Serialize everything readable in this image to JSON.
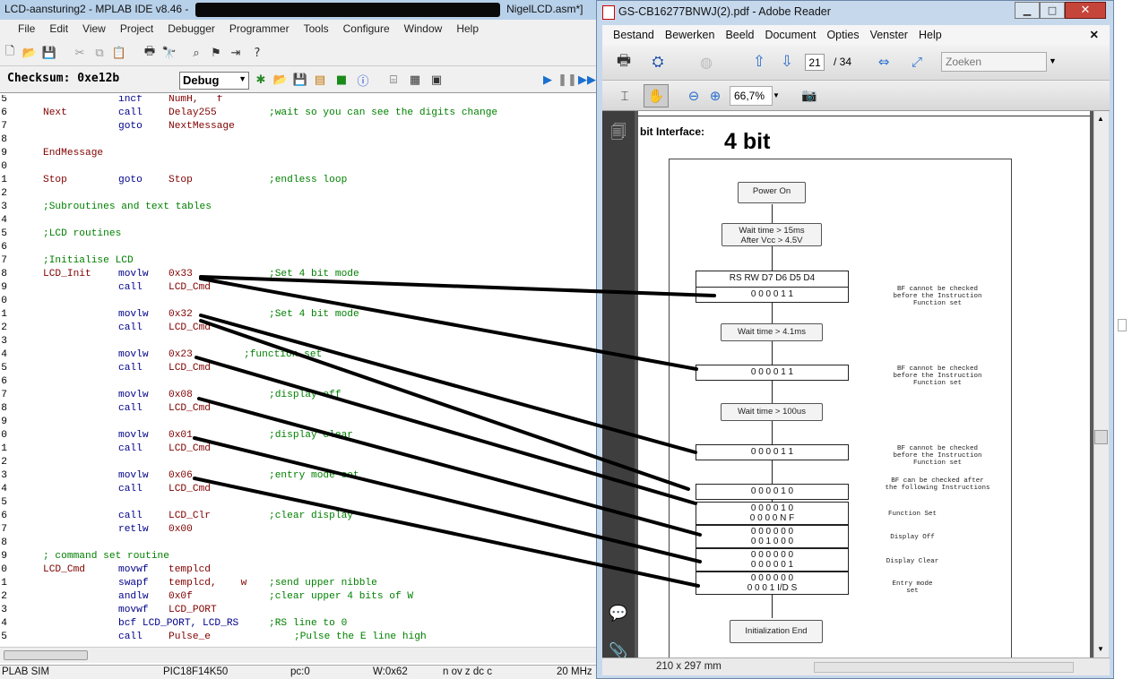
{
  "mplab": {
    "title_left": "LCD-aansturing2  - MPLAB IDE v8.46 -",
    "title_right": "NigelLCD.asm*]",
    "menu": [
      "File",
      "Edit",
      "View",
      "Project",
      "Debugger",
      "Programmer",
      "Tools",
      "Configure",
      "Window",
      "Help"
    ],
    "checksum_label": "Checksum:  0xe12b",
    "debug_select": "Debug",
    "code_lines": [
      {
        "ln": "5",
        "label": "",
        "ins": "incf",
        "opd": "NumH,   f",
        "cmt": ""
      },
      {
        "ln": "6",
        "label": "Next",
        "ins": "call",
        "opd": "Delay255",
        "cmt": ";wait so you can see the digits change"
      },
      {
        "ln": "7",
        "label": "",
        "ins": "goto",
        "opd": "NextMessage",
        "cmt": ""
      },
      {
        "ln": "8",
        "label": "",
        "ins": "",
        "opd": "",
        "cmt": ""
      },
      {
        "ln": "9",
        "label": "EndMessage",
        "ins": "",
        "opd": "",
        "cmt": ""
      },
      {
        "ln": "0",
        "label": "",
        "ins": "",
        "opd": "",
        "cmt": ""
      },
      {
        "ln": "1",
        "label": "Stop",
        "ins": "goto",
        "opd": "Stop",
        "cmt": ";endless loop"
      },
      {
        "ln": "2",
        "label": "",
        "ins": "",
        "opd": "",
        "cmt": ""
      },
      {
        "ln": "3",
        "full": ";Subroutines and text tables"
      },
      {
        "ln": "4",
        "label": "",
        "ins": "",
        "opd": "",
        "cmt": ""
      },
      {
        "ln": "5",
        "full": ";LCD routines"
      },
      {
        "ln": "6",
        "label": "",
        "ins": "",
        "opd": "",
        "cmt": ""
      },
      {
        "ln": "7",
        "full": ";Initialise LCD"
      },
      {
        "ln": "8",
        "label": "LCD_Init",
        "ins": "movlw",
        "opd": "0x33",
        "cmt": ";Set 4 bit mode"
      },
      {
        "ln": "9",
        "label": "",
        "ins": "call",
        "opd": "LCD_Cmd",
        "cmt": ""
      },
      {
        "ln": "0",
        "label": "",
        "ins": "",
        "opd": "",
        "cmt": ""
      },
      {
        "ln": "1",
        "label": "",
        "ins": "movlw",
        "opd": "0x32",
        "cmt": ";Set 4 bit mode"
      },
      {
        "ln": "2",
        "label": "",
        "ins": "call",
        "opd": "LCD_Cmd",
        "cmt": ""
      },
      {
        "ln": "3",
        "label": "",
        "ins": "",
        "opd": "",
        "cmt": ""
      },
      {
        "ln": "4",
        "label": "",
        "ins": "movlw",
        "opd": "0x23",
        "cmt": ";function set",
        "cmtpos": "short"
      },
      {
        "ln": "5",
        "label": "",
        "ins": "call",
        "opd": "LCD_Cmd",
        "cmt": ""
      },
      {
        "ln": "6",
        "label": "",
        "ins": "",
        "opd": "",
        "cmt": ""
      },
      {
        "ln": "7",
        "label": "",
        "ins": "movlw",
        "opd": "0x08",
        "cmt": ";display off"
      },
      {
        "ln": "8",
        "label": "",
        "ins": "call",
        "opd": "LCD_Cmd",
        "cmt": ""
      },
      {
        "ln": "9",
        "label": "",
        "ins": "",
        "opd": "",
        "cmt": ""
      },
      {
        "ln": "0",
        "label": "",
        "ins": "movlw",
        "opd": "0x01",
        "cmt": ";display clear"
      },
      {
        "ln": "1",
        "label": "",
        "ins": "call",
        "opd": "LCD_Cmd",
        "cmt": ""
      },
      {
        "ln": "2",
        "label": "",
        "ins": "",
        "opd": "",
        "cmt": ""
      },
      {
        "ln": "3",
        "label": "",
        "ins": "movlw",
        "opd": "0x06",
        "cmt": ";entry mode set"
      },
      {
        "ln": "4",
        "label": "",
        "ins": "call",
        "opd": "LCD_Cmd",
        "cmt": ""
      },
      {
        "ln": "5",
        "label": "",
        "ins": "",
        "opd": "",
        "cmt": ""
      },
      {
        "ln": "6",
        "label": "",
        "ins": "call",
        "opd": "LCD_Clr",
        "cmt": ";clear display"
      },
      {
        "ln": "7",
        "label": "",
        "ins": "retlw",
        "opd": "0x00",
        "cmt": ""
      },
      {
        "ln": "8",
        "label": "",
        "ins": "",
        "opd": "",
        "cmt": ""
      },
      {
        "ln": "9",
        "full": "; command set routine"
      },
      {
        "ln": "0",
        "label": "LCD_Cmd",
        "ins": "movwf",
        "opd": "templcd",
        "cmt": ""
      },
      {
        "ln": "1",
        "label": "",
        "ins": "swapf",
        "opd": "templcd,    w",
        "cmt": ";send upper nibble"
      },
      {
        "ln": "2",
        "label": "",
        "ins": "andlw",
        "opd": "0x0f",
        "cmt": ";clear upper 4 bits of W"
      },
      {
        "ln": "3",
        "label": "",
        "ins": "movwf",
        "opd": "LCD_PORT",
        "cmt": ""
      },
      {
        "ln": "4",
        "label": "",
        "ins": "bcf LCD_PORT, LCD_RS",
        "opd": "",
        "cmt": ";RS line to 0",
        "special": "bcf"
      },
      {
        "ln": "5",
        "label": "",
        "ins": "call",
        "opd": "Pulse_e",
        "cmt": ";Pulse the E line high",
        "cmtpos": "far"
      }
    ],
    "status": {
      "sim": "PLAB SIM",
      "chip": "PIC18F14K50",
      "pc": "pc:0",
      "w": "W:0x62",
      "flags": "n ov z dc c",
      "freq": "20 MHz"
    }
  },
  "reader": {
    "title": "GS-CB16277BNWJ(2).pdf - Adobe Reader",
    "menu": [
      "Bestand",
      "Bewerken",
      "Beeld",
      "Document",
      "Opties",
      "Venster",
      "Help"
    ],
    "page_current": "21",
    "page_total": "/ 34",
    "search_placeholder": "Zoeken",
    "zoom": "66,7%",
    "page_size": "210 x 297 mm",
    "doc": {
      "heading_left": "bit Interface:",
      "heading_big": "4 bit",
      "power_on": "Power On",
      "wait1_a": "Wait time > 15ms",
      "wait1_b": "After Vcc > 4.5V",
      "header_row": "RS  RW  D7  D6  D5  D4",
      "row_bits": "0   0   0   0   1   1",
      "wait2": "Wait time > 4.1ms",
      "wait3": "Wait time > 100us",
      "row_0010": "0   0   0   0   1   0",
      "row_fs_a": "0   0   0   0   1   0",
      "row_fs_b": "0   0   0   0   N   F",
      "row_do_a": "0   0   0   0   0   0",
      "row_do_b": "0   0   1   0   0   0",
      "row_dc_a": "0   0   0   0   0   0",
      "row_dc_b": "0   0   0   0   0   1",
      "row_em_a": "0   0   0   0   0   0",
      "row_em_b": "0   0   0   1  I/D  S",
      "end": "Initialization End",
      "note_bf": "BF cannot be checked before the Instruction Function set",
      "note_bf_after": "BF can be checked after the following Instructions",
      "label_fs": "Function Set",
      "label_do": "Display Off",
      "label_dc": "Display Clear",
      "label_em": "Entry mode set"
    }
  },
  "colors": {
    "accent": "#0b5fd0",
    "comment": "#008000",
    "label": "#800000",
    "instr": "#00008b"
  }
}
